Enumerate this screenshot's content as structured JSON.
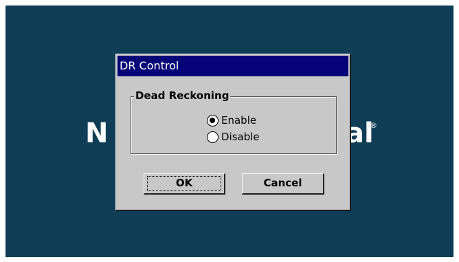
{
  "background": {
    "desktop_color": "#0f3d55"
  },
  "logo": {
    "left_fragment": "N",
    "right_fragment": "al",
    "registered_mark": "®"
  },
  "dialog": {
    "title": "DR Control",
    "title_bar_color": "#060378",
    "group": {
      "label": "Dead Reckoning",
      "options": [
        {
          "label": "Enable",
          "selected": true
        },
        {
          "label": "Disable",
          "selected": false
        }
      ]
    },
    "buttons": {
      "ok_label": "OK",
      "cancel_label": "Cancel"
    }
  }
}
